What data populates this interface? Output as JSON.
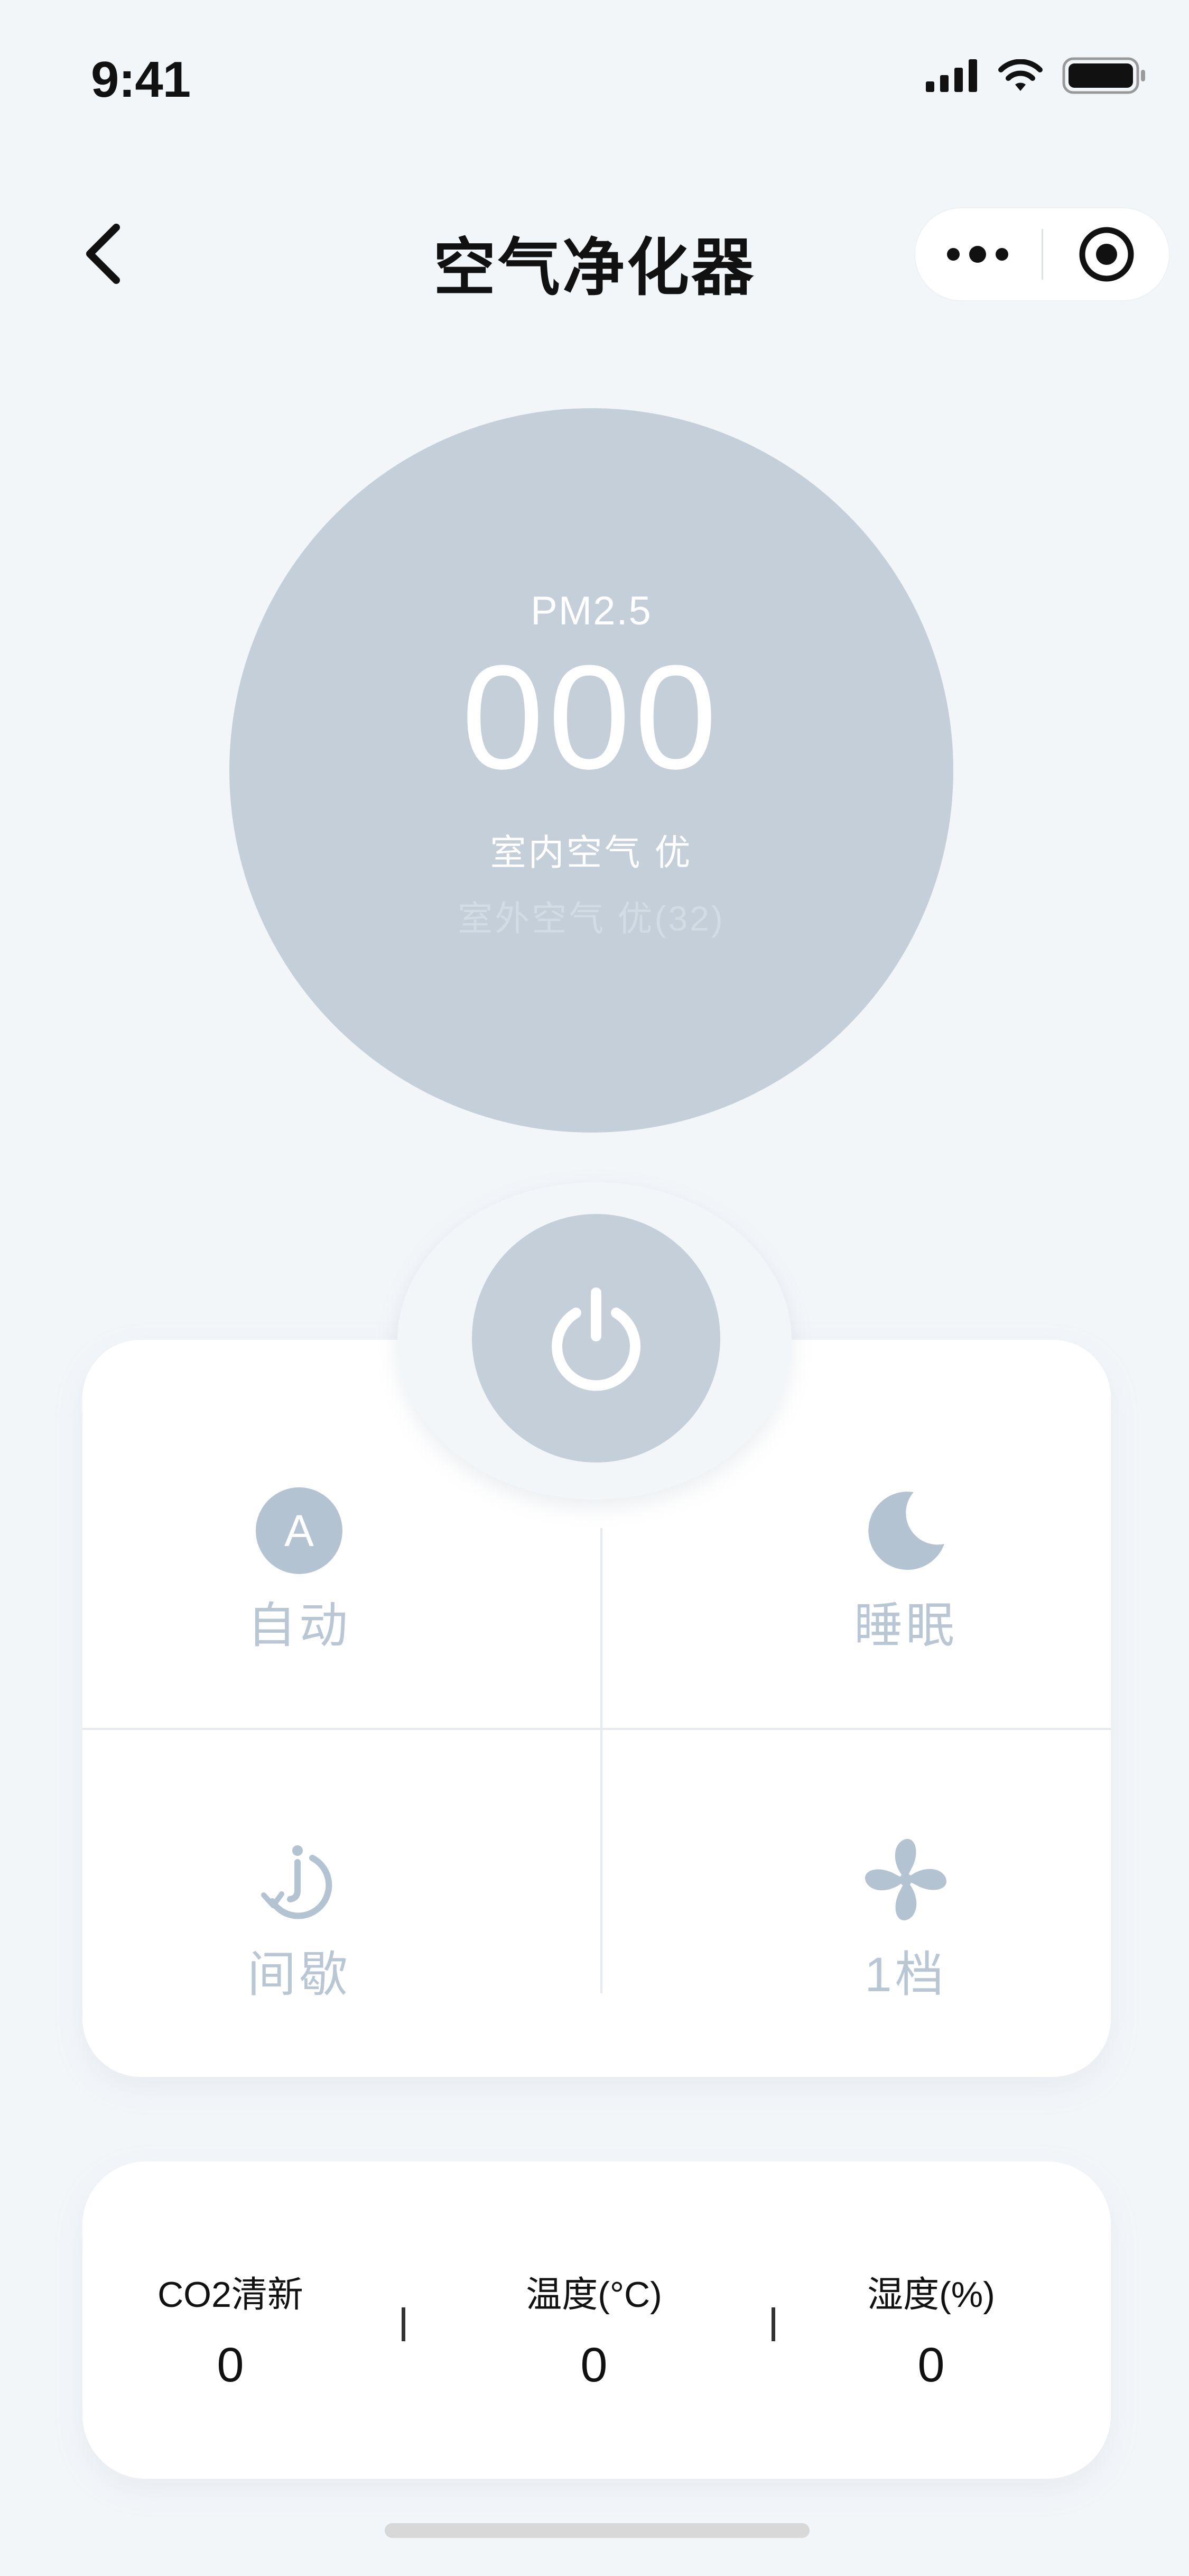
{
  "status_bar": {
    "time": "9:41"
  },
  "nav": {
    "title": "空气净化器"
  },
  "pm": {
    "label": "PM2.5",
    "value": "000",
    "indoor": "室内空气 优",
    "outdoor": "室外空气 优(32)"
  },
  "modes": {
    "auto": {
      "label": "自动",
      "badge": "A"
    },
    "sleep": {
      "label": "睡眠"
    },
    "interval": {
      "label": "间歇"
    },
    "level": {
      "label": "1档"
    }
  },
  "stats": {
    "co2": {
      "label": "CO2清新",
      "value": "0"
    },
    "temperature": {
      "label": "温度(°C)",
      "value": "0"
    },
    "humidity": {
      "label": "湿度(%)",
      "value": "0"
    }
  },
  "colors": {
    "background": "#f3f6f9",
    "disc": "#c4cfd9",
    "mode_label": "#b9c6d3",
    "card": "#ffffff"
  },
  "icons": [
    "back-icon",
    "more-icon",
    "target-icon",
    "power-icon",
    "auto-icon",
    "moon-icon",
    "timer-icon",
    "fan-icon"
  ]
}
